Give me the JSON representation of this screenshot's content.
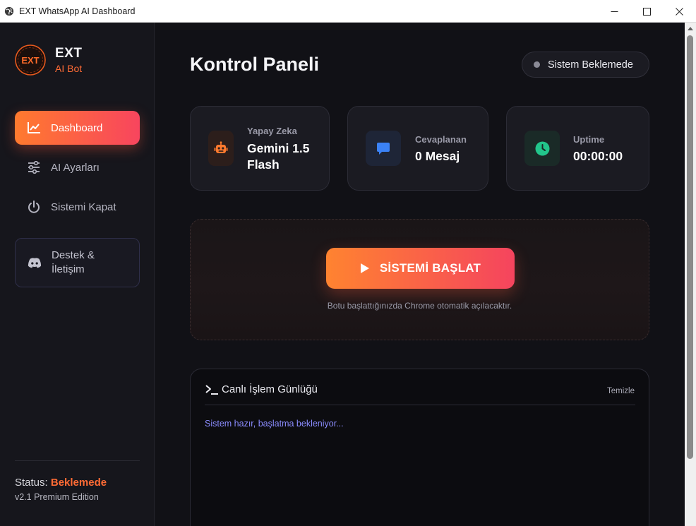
{
  "window": {
    "title": "EXT WhatsApp AI Dashboard",
    "icon": "globe-icon"
  },
  "sidebar": {
    "logo_text": "EXT",
    "brand_name": "EXT",
    "brand_sub": "AI Bot",
    "items": [
      {
        "label": "Dashboard",
        "icon": "chart-line-icon",
        "active": true
      },
      {
        "label": "AI Ayarları",
        "icon": "sliders-icon",
        "active": false
      },
      {
        "label": "Sistemi Kapat",
        "icon": "power-icon",
        "active": false
      }
    ],
    "support": {
      "label_line1": "Destek &",
      "label_line2": "İletişim",
      "icon": "discord-icon"
    },
    "status_label": "Status:",
    "status_value": "Beklemede",
    "version": "v2.1 Premium Edition"
  },
  "main": {
    "title": "Kontrol Paneli",
    "status_pill": "Sistem Beklemede",
    "cards": [
      {
        "label": "Yapay Zeka",
        "value_line1": "Gemini 1.5",
        "value_line2": "Flash",
        "icon": "robot-icon",
        "accent": "#ff7a2e"
      },
      {
        "label": "Cevaplanan",
        "value": "0 Mesaj",
        "icon": "message-icon",
        "accent": "#3b82f6"
      },
      {
        "label": "Uptime",
        "value": "00:00:00",
        "icon": "clock-icon",
        "accent": "#22c58b"
      }
    ],
    "start_button": "SİSTEMİ BAŞLAT",
    "start_hint": "Botu başlattığınızda Chrome otomatik açılacaktır.",
    "log": {
      "title": "Canlı İşlem Günlüğü",
      "clear": "Temizle",
      "lines": [
        "Sistem hazır, başlatma bekleniyor..."
      ]
    }
  },
  "colors": {
    "accent_orange": "#ff7a2e",
    "accent_pink": "#f5445e",
    "background": "#111116",
    "sidebar": "#16161c",
    "log_text": "#8b8cff"
  }
}
